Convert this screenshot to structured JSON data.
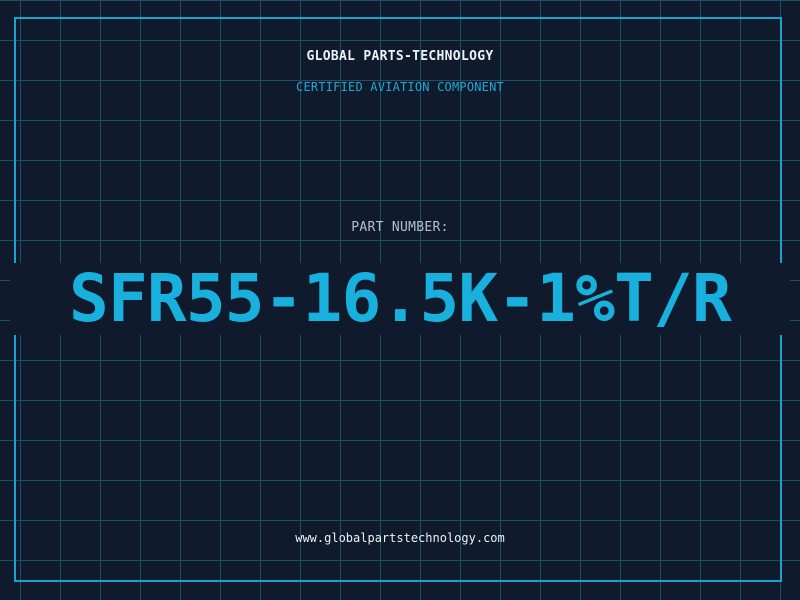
{
  "header": {
    "company": "GLOBAL PARTS-TECHNOLOGY",
    "subtitle": "CERTIFIED AVIATION COMPONENT"
  },
  "part": {
    "label": "PART NUMBER:",
    "number": "SFR55-16.5K-1%T/R"
  },
  "footer": {
    "url": "www.globalpartstechnology.com"
  },
  "colors": {
    "background": "#0f1a2c",
    "grid": "#19506a",
    "accent": "#18b0dd",
    "text": "#eef2f6",
    "muted": "#b7c0cc"
  }
}
